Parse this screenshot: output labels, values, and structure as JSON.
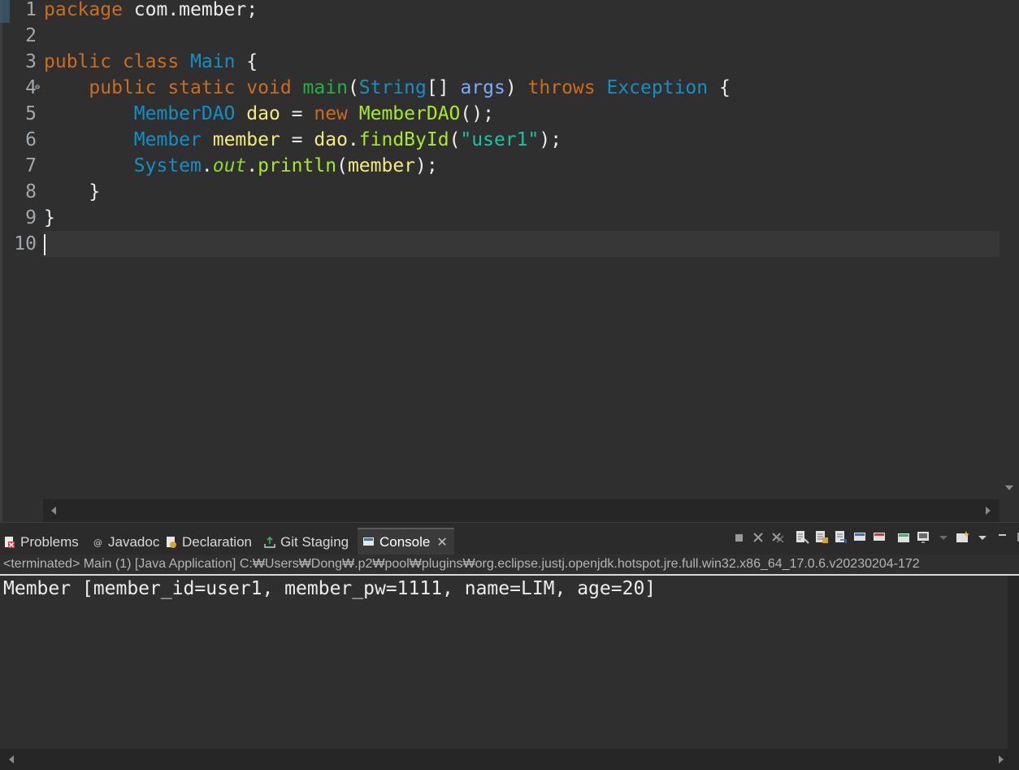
{
  "editor": {
    "line_numbers": [
      "1",
      "2",
      "3",
      "4",
      "5",
      "6",
      "7",
      "8",
      "9",
      "10"
    ],
    "fold_marker": "⊖",
    "lines": [
      [
        {
          "t": "package",
          "c": "kw"
        },
        {
          "t": " com.member;",
          "c": "ot"
        }
      ],
      [],
      [
        {
          "t": "public",
          "c": "kw"
        },
        {
          "t": " ",
          "c": "ot"
        },
        {
          "t": "class",
          "c": "kw"
        },
        {
          "t": " ",
          "c": "ot"
        },
        {
          "t": "Main",
          "c": "ty"
        },
        {
          "t": " {",
          "c": "ot"
        }
      ],
      [
        {
          "t": "    ",
          "c": "ot"
        },
        {
          "t": "public",
          "c": "kw"
        },
        {
          "t": " ",
          "c": "ot"
        },
        {
          "t": "static",
          "c": "kw"
        },
        {
          "t": " ",
          "c": "ot"
        },
        {
          "t": "void",
          "c": "kw"
        },
        {
          "t": " ",
          "c": "ot"
        },
        {
          "t": "main",
          "c": "fn"
        },
        {
          "t": "(",
          "c": "ot"
        },
        {
          "t": "String",
          "c": "ty"
        },
        {
          "t": "[] ",
          "c": "ot"
        },
        {
          "t": "args",
          "c": "pr"
        },
        {
          "t": ") ",
          "c": "ot"
        },
        {
          "t": "throws",
          "c": "kw"
        },
        {
          "t": " ",
          "c": "ot"
        },
        {
          "t": "Exception",
          "c": "ty"
        },
        {
          "t": " {",
          "c": "ot"
        }
      ],
      [
        {
          "t": "        ",
          "c": "ot"
        },
        {
          "t": "MemberDAO",
          "c": "ty"
        },
        {
          "t": " ",
          "c": "ot"
        },
        {
          "t": "dao",
          "c": "ld"
        },
        {
          "t": " = ",
          "c": "ot"
        },
        {
          "t": "new",
          "c": "kw"
        },
        {
          "t": " ",
          "c": "ot"
        },
        {
          "t": "MemberDAO",
          "c": "mth"
        },
        {
          "t": "();",
          "c": "ot"
        }
      ],
      [
        {
          "t": "        ",
          "c": "ot"
        },
        {
          "t": "Member",
          "c": "ty"
        },
        {
          "t": " ",
          "c": "ot"
        },
        {
          "t": "member",
          "c": "ld"
        },
        {
          "t": " = ",
          "c": "ot"
        },
        {
          "t": "dao",
          "c": "ld"
        },
        {
          "t": ".",
          "c": "ot"
        },
        {
          "t": "findById",
          "c": "mth"
        },
        {
          "t": "(",
          "c": "ot"
        },
        {
          "t": "\"user1\"",
          "c": "st"
        },
        {
          "t": ");",
          "c": "ot"
        }
      ],
      [
        {
          "t": "        ",
          "c": "ot"
        },
        {
          "t": "System",
          "c": "ty"
        },
        {
          "t": ".",
          "c": "ot"
        },
        {
          "t": "out",
          "c": "stc"
        },
        {
          "t": ".",
          "c": "ot"
        },
        {
          "t": "println",
          "c": "mth"
        },
        {
          "t": "(",
          "c": "ot"
        },
        {
          "t": "member",
          "c": "ld"
        },
        {
          "t": ");",
          "c": "ot"
        }
      ],
      [
        {
          "t": "    }",
          "c": "ot"
        }
      ],
      [
        {
          "t": "}",
          "c": "ot"
        }
      ],
      []
    ]
  },
  "views": {
    "tabs": [
      {
        "label": "Problems",
        "icon": "problems-icon"
      },
      {
        "label": "Javadoc",
        "icon": "javadoc-icon"
      },
      {
        "label": "Declaration",
        "icon": "declaration-icon"
      },
      {
        "label": "Git Staging",
        "icon": "git-staging-icon"
      },
      {
        "label": "Console",
        "icon": "console-icon",
        "active": true
      }
    ],
    "close_glyph": "✕"
  },
  "console": {
    "status": "<terminated> Main (1) [Java Application] C:₩Users₩Dong₩.p2₩pool₩plugins₩org.eclipse.justj.openjdk.hotspot.jre.full.win32.x86_64_17.0.6.v20230204-172",
    "output": "Member [member_id=user1, member_pw=1111, name=LIM, age=20]"
  },
  "colors": {
    "background": "#2f2f2f",
    "keyword": "#cc6c1d",
    "type": "#1290c3",
    "method_decl": "#1eb540",
    "local_var": "#f3ec79",
    "method_call": "#a7ec21",
    "parameter": "#79abff",
    "string": "#17c6a3",
    "text": "#ececec"
  }
}
